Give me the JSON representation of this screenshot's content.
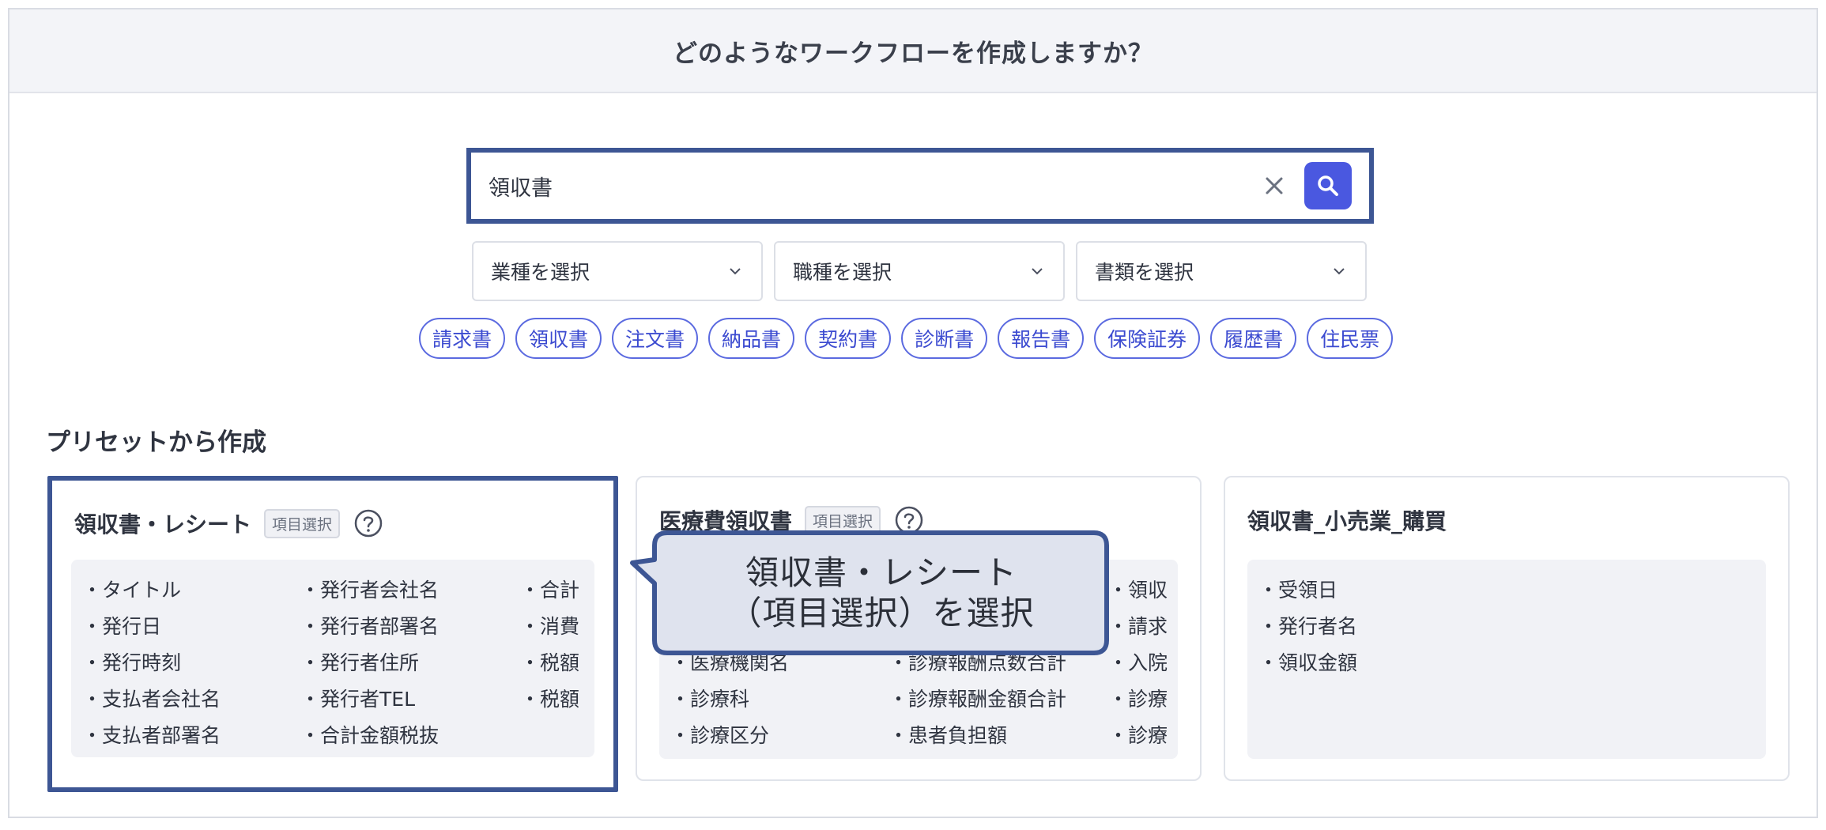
{
  "header": {
    "title": "どのようなワークフローを作成しますか？"
  },
  "search": {
    "value": "領収書",
    "placeholder": ""
  },
  "filters": {
    "industry_label": "業種を選択",
    "occupation_label": "職種を選択",
    "document_label": "書類を選択"
  },
  "chips": [
    "請求書",
    "領収書",
    "注文書",
    "納品書",
    "契約書",
    "診断書",
    "報告書",
    "保険証券",
    "履歴書",
    "住民票"
  ],
  "section": {
    "title": "プリセットから作成"
  },
  "cards": [
    {
      "title": "領収書・レシート",
      "tag": "項目選択",
      "col1": [
        "・タイトル",
        "・発行日",
        "・発行時刻",
        "・支払者会社名",
        "・支払者部署名"
      ],
      "col2": [
        "・発行者会社名",
        "・発行者部署名",
        "・発行者住所",
        "・発行者TEL",
        "・合計金額税抜"
      ],
      "col3": [
        "・合計",
        "・消費",
        "・税額",
        "・税額"
      ]
    },
    {
      "title": "医療費領収書",
      "tag": "項目選択",
      "col1": [
        "・医療機関名",
        "・診療科",
        "・診療区分"
      ],
      "col2": [
        "・診療報酬点数合計",
        "・診療報酬金額合計",
        "・患者負担額"
      ],
      "col3": [
        "・領収",
        "・請求",
        "・入院",
        "・診療",
        "・診療"
      ]
    },
    {
      "title": "領収書_小売業_購買",
      "tag": "",
      "col1": [
        "・受領日",
        "・発行者名",
        "・領収金額"
      ]
    }
  ],
  "callout": {
    "line1": "領収書・レシート",
    "line2": "（項目選択）を選択"
  },
  "colors": {
    "accent": "#4a58e0",
    "highlight_border": "#3d5694",
    "callout_fill": "#dfe3ee"
  },
  "icons": {
    "clear": "close-icon",
    "search": "search-icon",
    "select": "chevron-down-icon",
    "help": "help-circle-icon"
  }
}
